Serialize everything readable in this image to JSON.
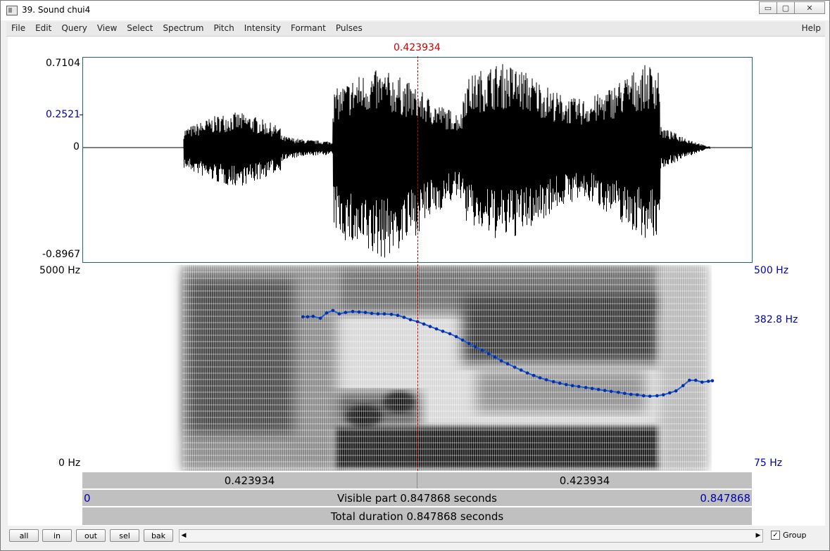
{
  "window": {
    "title": "39. Sound chui4",
    "minimize": "▭",
    "maximize": "▢",
    "close": "✕"
  },
  "menu": {
    "items": [
      "File",
      "Edit",
      "Query",
      "View",
      "Select",
      "Spectrum",
      "Pitch",
      "Intensity",
      "Formant",
      "Pulses"
    ],
    "help": "Help"
  },
  "cursor": {
    "time_label": "0.423934",
    "time": 0.423934
  },
  "waveform": {
    "max_label": "0.7104",
    "mid_label": "0.2521",
    "zero_label": "0",
    "min_label": "-0.8967"
  },
  "spectrogram": {
    "top_freq": "5000 Hz",
    "bottom_freq": "0 Hz"
  },
  "pitch": {
    "top": "500 Hz",
    "mid": "382.8 Hz",
    "bottom": "75 Hz"
  },
  "chart_data": {
    "type": "line",
    "title": "",
    "xlabel": "",
    "ylabel": "",
    "xlim": [
      0,
      0.847868
    ],
    "ylim": [
      75,
      500
    ],
    "series": [
      {
        "x": [
          0.279,
          0.285,
          0.292,
          0.301,
          0.309,
          0.317,
          0.325,
          0.333,
          0.342,
          0.35,
          0.358,
          0.366,
          0.374,
          0.382,
          0.391,
          0.399,
          0.407,
          0.415,
          0.424,
          0.432,
          0.44,
          0.448,
          0.456,
          0.465,
          0.473,
          0.481,
          0.489,
          0.497,
          0.506,
          0.514,
          0.522,
          0.53,
          0.538,
          0.547,
          0.555,
          0.563,
          0.571,
          0.579,
          0.587,
          0.596,
          0.604,
          0.612,
          0.62,
          0.628,
          0.637,
          0.645,
          0.653,
          0.661,
          0.669,
          0.678,
          0.686,
          0.694,
          0.702,
          0.71,
          0.718,
          0.727,
          0.735,
          0.743,
          0.751,
          0.76,
          0.768,
          0.776,
          0.784,
          0.792,
          0.797
        ],
        "y": [
          393,
          393,
          394,
          390,
          401,
          406,
          399,
          402,
          404,
          403,
          402,
          400,
          399,
          399,
          398,
          396,
          392,
          387,
          383,
          378,
          373,
          368,
          363,
          358,
          352,
          345,
          338,
          331,
          324,
          317,
          310,
          302,
          296,
          289,
          283,
          277,
          272,
          267,
          263,
          259,
          256,
          253,
          251,
          249,
          247,
          245,
          243,
          241,
          239,
          237,
          235,
          233,
          232,
          230,
          229,
          230,
          232,
          236,
          240,
          251,
          262,
          262,
          258,
          260,
          261
        ]
      }
    ]
  },
  "time_bar": {
    "left": "0.423934",
    "right": "0.423934"
  },
  "visible_bar": {
    "start": "0",
    "label": "Visible part 0.847868 seconds",
    "end": "0.847868"
  },
  "total_bar": {
    "label": "Total duration 0.847868 seconds"
  },
  "buttons": {
    "all": "all",
    "in": "in",
    "out": "out",
    "sel": "sel",
    "bak": "bak"
  },
  "scroll": {
    "left_arrow": "◀",
    "right_arrow": "▶"
  },
  "group": {
    "label": "Group",
    "checked": true,
    "mark": "✓"
  }
}
